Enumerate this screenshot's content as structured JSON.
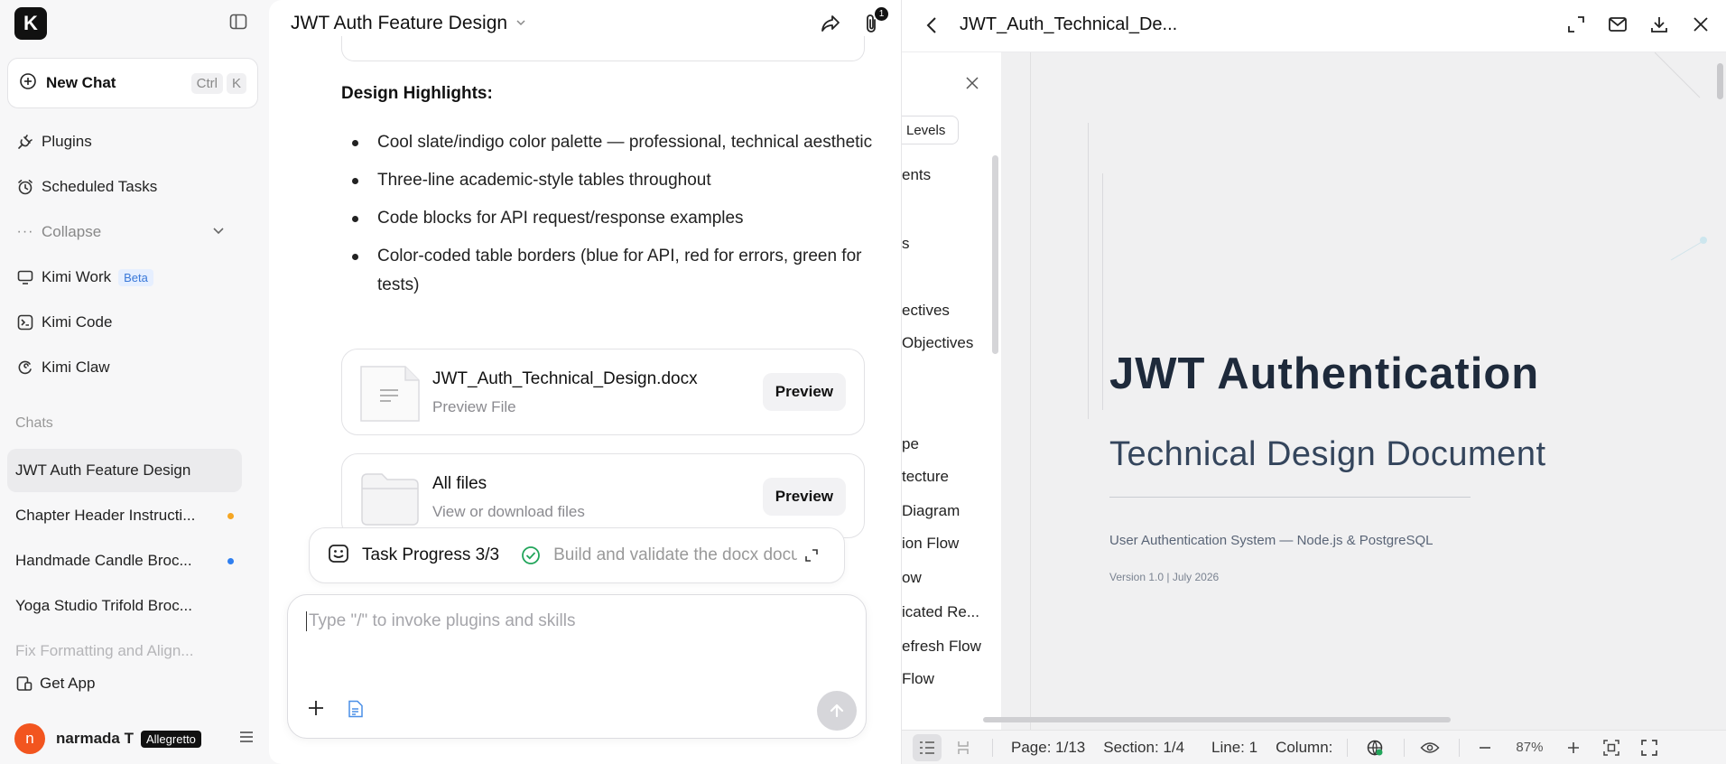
{
  "sidebar": {
    "logo_letter": "K",
    "new_chat": {
      "label": "New Chat",
      "kbd1": "Ctrl",
      "kbd2": "K"
    },
    "nav": [
      {
        "label": "Plugins"
      },
      {
        "label": "Scheduled Tasks"
      },
      {
        "label": "Collapse"
      },
      {
        "label": "Kimi Work",
        "badge": "Beta"
      },
      {
        "label": "Kimi Code"
      },
      {
        "label": "Kimi Claw"
      }
    ],
    "chats_label": "Chats",
    "chats": [
      {
        "title": "JWT Auth Feature Design"
      },
      {
        "title": "Chapter Header Instructi...",
        "dot_color": "#f5a623"
      },
      {
        "title": "Handmade Candle Broc...",
        "dot_color": "#2f7ff0"
      },
      {
        "title": "Yoga Studio Trifold Broc..."
      },
      {
        "title": "Fix Formatting and Align..."
      }
    ],
    "get_app": "Get App",
    "user": {
      "initial": "n",
      "name": "narmada T",
      "plan": "Allegretto"
    }
  },
  "chat": {
    "title": "JWT Auth Feature Design",
    "attachment_count": "1",
    "design_heading": "Design Highlights:",
    "highlights": [
      "Cool slate/indigo color palette — professional, technical aesthetic",
      "Three-line academic-style tables throughout",
      "Code blocks for API request/response examples",
      "Color-coded table borders (blue for API, red for errors, green for tests)"
    ],
    "files": [
      {
        "name": "JWT_Auth_Technical_Design.docx",
        "sub": "Preview File",
        "button": "Preview"
      },
      {
        "name": "All files",
        "sub": "View or download files",
        "button": "Preview"
      }
    ],
    "task": {
      "label": "Task Progress 3/3",
      "step": "Build and validate the docx document"
    },
    "composer": {
      "placeholder": "Type \"/\" to invoke plugins and skills"
    }
  },
  "preview": {
    "title": "JWT_Auth_Technical_De...",
    "outline": {
      "levels_label": "Levels",
      "items": [
        "ents",
        "s",
        "ectives",
        "Objectives",
        "pe",
        "tecture",
        "Diagram",
        "ion Flow",
        "ow",
        "icated Re...",
        "efresh Flow",
        "Flow"
      ]
    },
    "doc": {
      "title": "JWT Authentication",
      "subtitle": "Technical Design Document",
      "meta": "User Authentication System — Node.js & PostgreSQL",
      "version": "Version 1.0  |  July 2026"
    },
    "status": {
      "page": "Page: 1/13",
      "section": "Section: 1/4",
      "line": "Line: 1",
      "column": "Column:",
      "zoom": "87%"
    }
  }
}
